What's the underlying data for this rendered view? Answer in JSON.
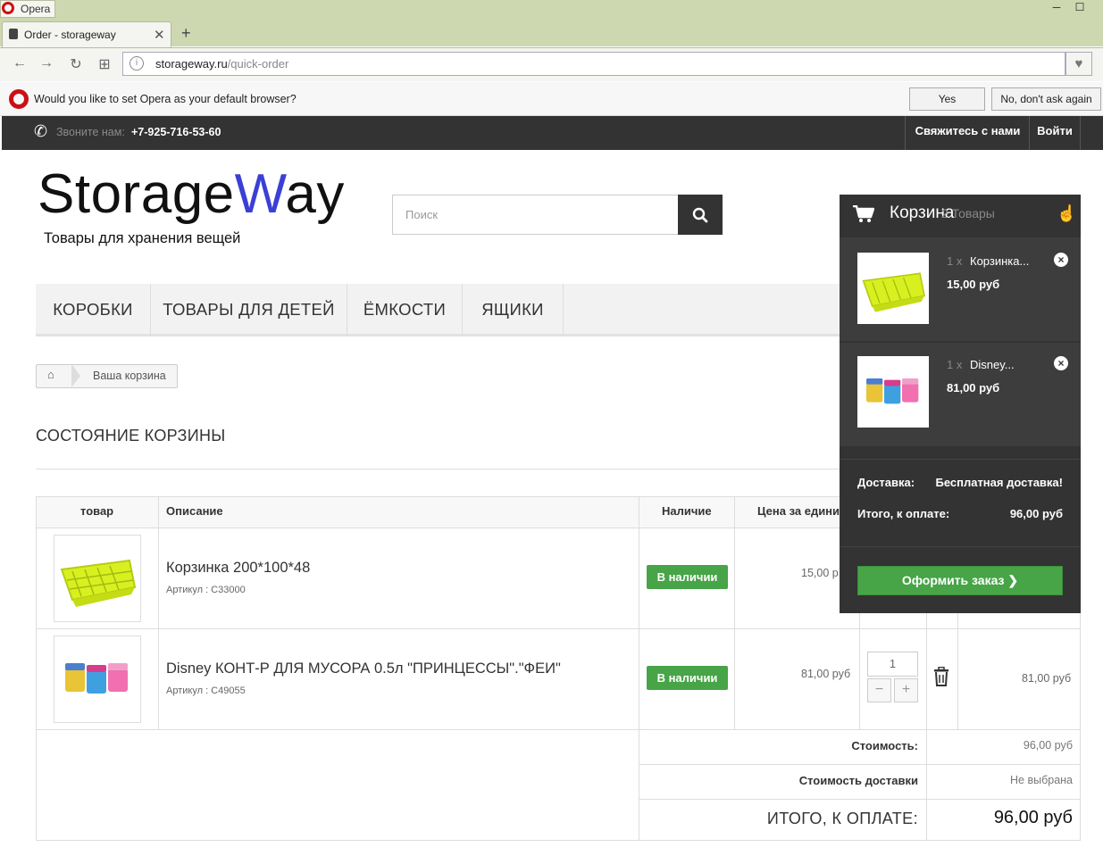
{
  "browser": {
    "app_name": "Opera",
    "tab_title": "Order - storageway",
    "url_host": "storageway.ru",
    "url_path": "/quick-order",
    "infobar_text": "Would you like to set Opera as your default browser?",
    "infobar_yes": "Yes",
    "infobar_no": "No, don't ask again"
  },
  "topbar": {
    "phone_label": "Звоните нам:",
    "phone": "+7-925-716-53-60",
    "contact": "Свяжитесь с нами",
    "login": "Войти"
  },
  "site": {
    "logo_main": "Storage",
    "logo_w": "W",
    "logo_end": "ay",
    "tagline": "Товары для хранения вещей",
    "search_placeholder": "Поиск"
  },
  "menu": [
    "КОРОБКИ",
    "ТОВАРЫ ДЛЯ ДЕТЕЙ",
    "ЁМКОСТИ",
    "ЯЩИКИ"
  ],
  "breadcrumb": {
    "current": "Ваша корзина"
  },
  "page_title": "СОСТОЯНИЕ КОРЗИНЫ",
  "table": {
    "headers": [
      "товар",
      "Описание",
      "Наличие",
      "Цена за едини"
    ],
    "rows": [
      {
        "name": "Корзинка 200*100*48",
        "sku": "Артикул : C33000",
        "stock": "В наличии",
        "price": "15,00 р"
      },
      {
        "name": "Disney КОНТ-Р ДЛЯ МУСОРА 0.5л \"ПРИНЦЕССЫ\".\"ФЕИ\"",
        "sku": "Артикул : C49055",
        "stock": "В наличии",
        "price": "81,00 руб",
        "qty": "1",
        "total": "81,00 руб"
      }
    ],
    "summary": {
      "cost_label": "Стоимость:",
      "cost_value": "96,00 руб",
      "delivery_label": "Стоимость доставки",
      "delivery_value": "Не выбрана",
      "total_label": "ИТОГО, К ОПЛАТЕ:",
      "total_value": "96,00 руб"
    }
  },
  "cart": {
    "title": "Корзина",
    "count": "2 Товары",
    "items": [
      {
        "qty": "1 x",
        "name": "Корзинка...",
        "price": "15,00 руб"
      },
      {
        "qty": "1 x",
        "name": "Disney...",
        "price": "81,00 руб"
      }
    ],
    "delivery_label": "Доставка:",
    "delivery_value": "Бесплатная доставка!",
    "total_label": "Итого, к оплате:",
    "total_value": "96,00 руб",
    "checkout": "Оформить заказ"
  },
  "colors": {
    "accent": "#47a447",
    "dark": "#333333",
    "logo_w": "#3a3fd6"
  }
}
